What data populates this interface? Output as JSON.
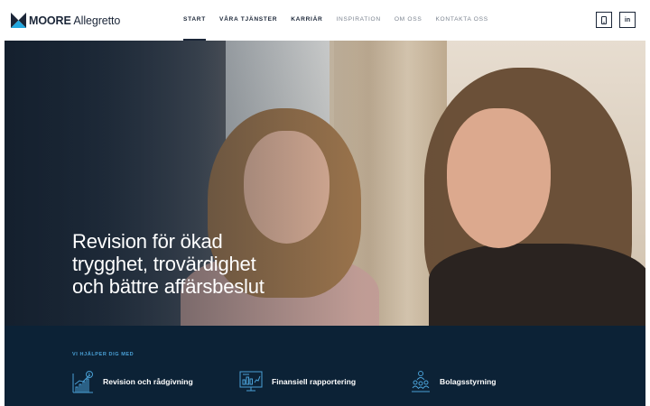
{
  "brand": {
    "name_bold": "MOORE",
    "name_rest": " Allegretto",
    "logo_icon": "moore-m-logo-icon"
  },
  "nav": {
    "items": [
      {
        "label": "START",
        "active": true
      },
      {
        "label": "VÅRA TJÄNSTER"
      },
      {
        "label": "KARRIÄR"
      },
      {
        "label": "INSPIRATION"
      },
      {
        "label": "OM OSS"
      },
      {
        "label": "KONTAKTA OSS"
      }
    ]
  },
  "header_actions": {
    "linkedin_label": "in",
    "phone_icon": "phone-icon"
  },
  "hero": {
    "title_lines": [
      "Revision för ökad",
      "trygghet, trovärdighet",
      "och bättre affärsbeslut"
    ]
  },
  "services": {
    "label": "VI HJÄLPER DIG MED",
    "items": [
      {
        "label": "Revision och rådgivning",
        "icon": "growth-chart-icon"
      },
      {
        "label": "Finansiell rapportering",
        "icon": "report-screen-icon"
      },
      {
        "label": "Bolagsstyrning",
        "icon": "governance-people-icon"
      }
    ]
  },
  "colors": {
    "navy": "#0c2236",
    "brand_dark": "#1b2638",
    "accent_blue": "#4aa0d6",
    "logo_teal": "#23a8e0"
  }
}
